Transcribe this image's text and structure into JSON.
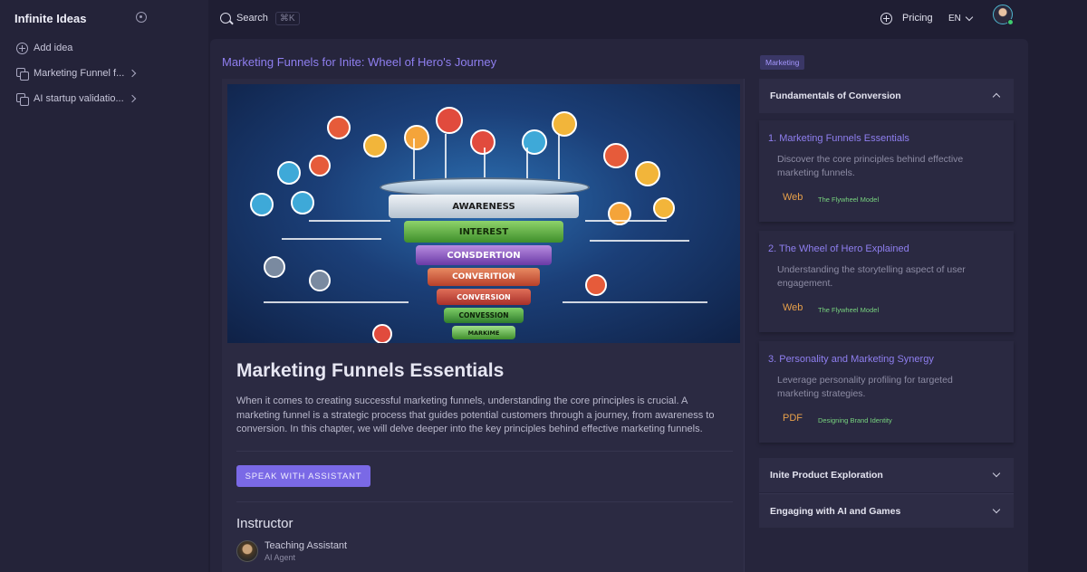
{
  "sidebar": {
    "brand": "Infinite Ideas",
    "items": [
      {
        "label": "Add idea",
        "icon": "plus-circle-icon"
      },
      {
        "label": "Marketing Funnel f...",
        "icon": "copy-icon"
      },
      {
        "label": "AI startup validatio...",
        "icon": "copy-icon"
      }
    ]
  },
  "topbar": {
    "search_label": "Search",
    "search_shortcut": "⌘K",
    "pricing_label": "Pricing",
    "language": "EN"
  },
  "main": {
    "idea_title": "Marketing Funnels for Inite: Wheel of Hero's Journey",
    "hero_image": {
      "funnel_layers": [
        "AWARENESS",
        "INTEREST",
        "CONSDERTION",
        "CONVERITION",
        "CONVERSION",
        "CONVESSION",
        "MARKIME"
      ]
    },
    "content_title": "Marketing Funnels Essentials",
    "content_body": "When it comes to creating successful marketing funnels, understanding the core principles is crucial. A marketing funnel is a strategic process that guides potential customers through a journey, from awareness to conversion. In this chapter, we will delve deeper into the key principles behind effective marketing funnels.",
    "speak_button": "SPEAK WITH ASSISTANT",
    "instructor": {
      "heading": "Instructor",
      "name": "Teaching Assistant",
      "role": "AI Agent"
    }
  },
  "right": {
    "tag": "Marketing",
    "sections": [
      {
        "title": "Fundamentals of Conversion",
        "expanded": true,
        "lessons": [
          {
            "title": "1. Marketing Funnels Essentials",
            "desc": "Discover the core principles behind effective marketing funnels.",
            "type": "Web",
            "ref": "The Flywheel Model"
          },
          {
            "title": "2. The Wheel of Hero Explained",
            "desc": "Understanding the storytelling aspect of user engagement.",
            "type": "Web",
            "ref": "The Flywheel Model"
          },
          {
            "title": "3. Personality and Marketing Synergy",
            "desc": "Leverage personality profiling for targeted marketing strategies.",
            "type": "PDF",
            "ref": "Designing Brand Identity"
          }
        ]
      },
      {
        "title": "Inite Product Exploration",
        "expanded": false
      },
      {
        "title": "Engaging with AI and Games",
        "expanded": false
      }
    ]
  },
  "colors": {
    "accent": "#7a69e6",
    "link": "#8f7ff0",
    "type_badge": "#e7a04a",
    "ref_text": "#77d27e"
  }
}
